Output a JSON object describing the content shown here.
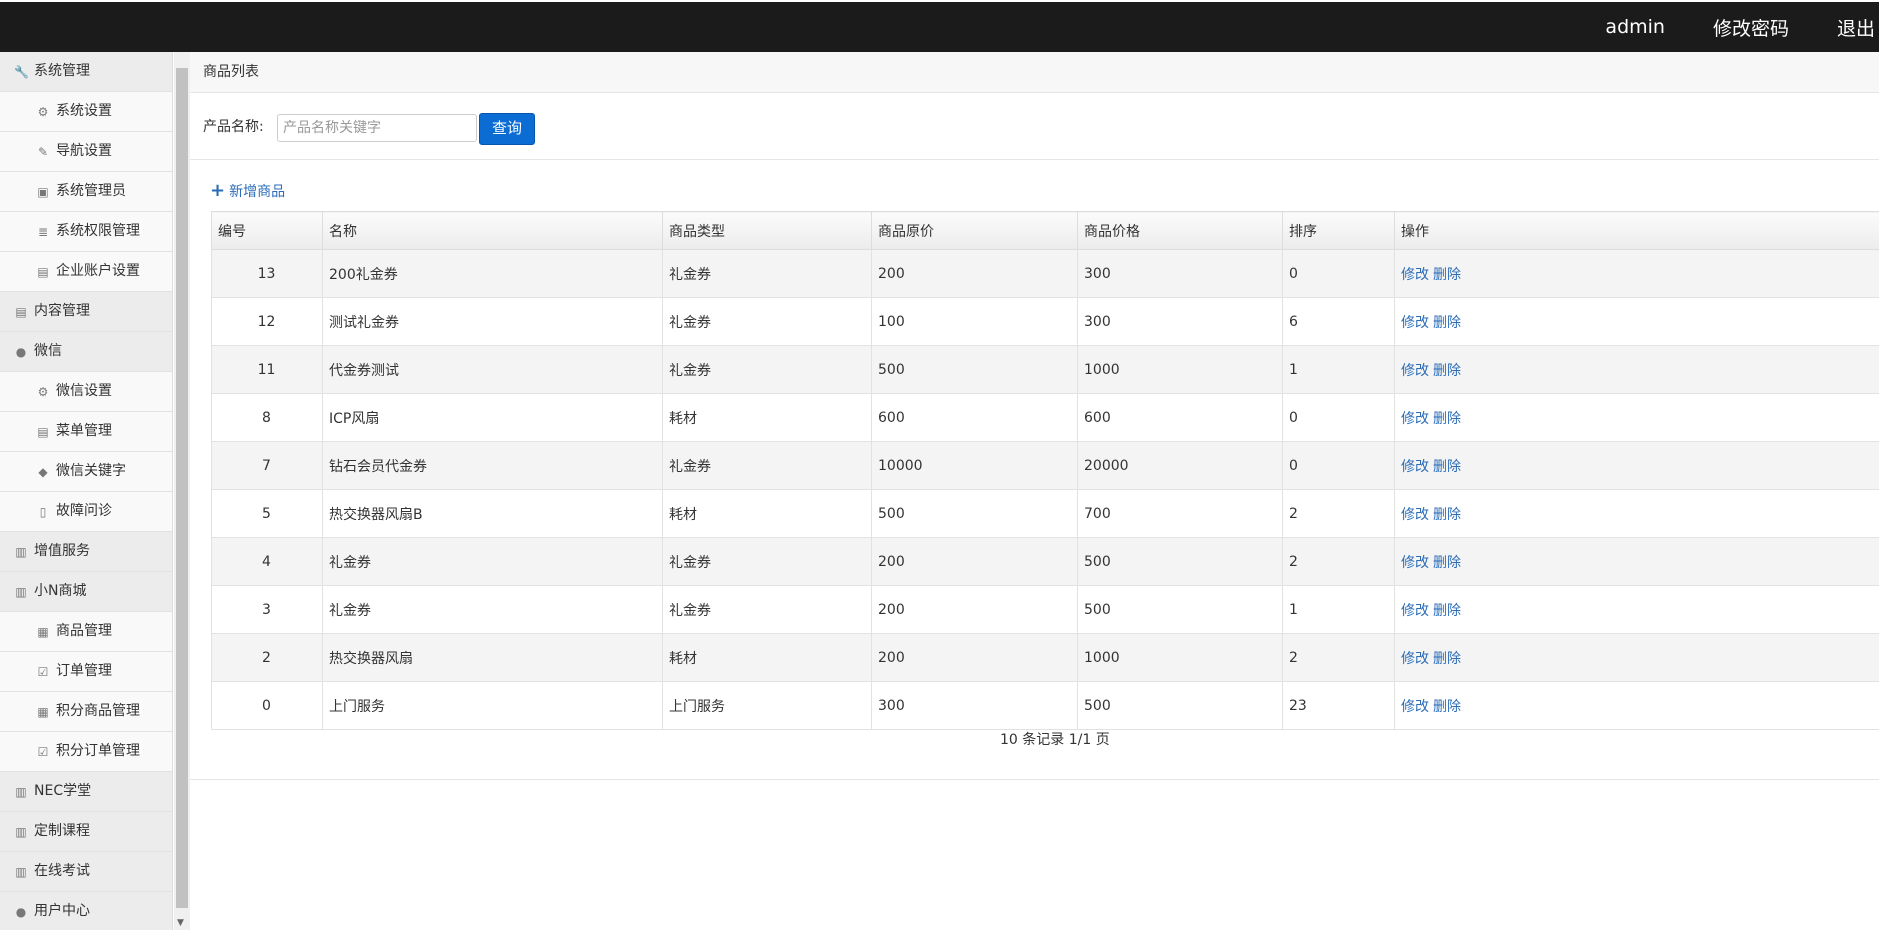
{
  "topbar": {
    "user": "admin",
    "change_password": "修改密码",
    "logout": "退出"
  },
  "sidebar": {
    "items": [
      {
        "label": "系统管理",
        "type": "group",
        "icon": "wrench-icon"
      },
      {
        "label": "系统设置",
        "type": "sub",
        "icon": "gear-icon"
      },
      {
        "label": "导航设置",
        "type": "sub",
        "icon": "pencil-icon"
      },
      {
        "label": "系统管理员",
        "type": "sub",
        "icon": "user-card-icon"
      },
      {
        "label": "系统权限管理",
        "type": "sub",
        "icon": "list-icon"
      },
      {
        "label": "企业账户设置",
        "type": "sub",
        "icon": "building-icon"
      },
      {
        "label": "内容管理",
        "type": "group",
        "icon": "document-icon"
      },
      {
        "label": "微信",
        "type": "group",
        "icon": "chat-icon"
      },
      {
        "label": "微信设置",
        "type": "sub",
        "icon": "gear-icon"
      },
      {
        "label": "菜单管理",
        "type": "sub",
        "icon": "document-icon"
      },
      {
        "label": "微信关键字",
        "type": "sub",
        "icon": "tag-icon"
      },
      {
        "label": "故障问诊",
        "type": "sub",
        "icon": "clipboard-icon"
      },
      {
        "label": "增值服务",
        "type": "group",
        "icon": "books-icon"
      },
      {
        "label": "小N商城",
        "type": "group",
        "icon": "books-icon"
      },
      {
        "label": "商品管理",
        "type": "sub",
        "icon": "gift-icon"
      },
      {
        "label": "订单管理",
        "type": "sub",
        "icon": "check-box-icon"
      },
      {
        "label": "积分商品管理",
        "type": "sub",
        "icon": "gift-icon"
      },
      {
        "label": "积分订单管理",
        "type": "sub",
        "icon": "check-box-icon"
      },
      {
        "label": "NEC学堂",
        "type": "group",
        "icon": "books-icon"
      },
      {
        "label": "定制课程",
        "type": "group",
        "icon": "books-icon"
      },
      {
        "label": "在线考试",
        "type": "group",
        "icon": "books-icon"
      },
      {
        "label": "用户中心",
        "type": "group",
        "icon": "user-icon"
      }
    ]
  },
  "main": {
    "breadcrumb": "商品列表",
    "search": {
      "label": "产品名称:",
      "placeholder": "产品名称关键字",
      "button": "查询"
    },
    "add_label": "新增商品",
    "table": {
      "headers": [
        "编号",
        "名称",
        "商品类型",
        "商品原价",
        "商品价格",
        "排序",
        "操作"
      ],
      "edit_label": "修改",
      "delete_label": "删除",
      "rows": [
        [
          "13",
          "200礼金券",
          "礼金券",
          "200",
          "300",
          "0"
        ],
        [
          "12",
          "测试礼金券",
          "礼金券",
          "100",
          "300",
          "6"
        ],
        [
          "11",
          "代金券测试",
          "礼金券",
          "500",
          "1000",
          "1"
        ],
        [
          "8",
          "ICP风扇",
          "耗材",
          "600",
          "600",
          "0"
        ],
        [
          "7",
          "钻石会员代金券",
          "礼金券",
          "10000",
          "20000",
          "0"
        ],
        [
          "5",
          "热交换器风扇B",
          "耗材",
          "500",
          "700",
          "2"
        ],
        [
          "4",
          "礼金券",
          "礼金券",
          "200",
          "500",
          "2"
        ],
        [
          "3",
          "礼金券",
          "礼金券",
          "200",
          "500",
          "1"
        ],
        [
          "2",
          "热交换器风扇",
          "耗材",
          "200",
          "1000",
          "2"
        ],
        [
          "0",
          "上门服务",
          "上门服务",
          "300",
          "500",
          "23"
        ]
      ]
    },
    "pager": "10 条记录 1/1 页"
  }
}
